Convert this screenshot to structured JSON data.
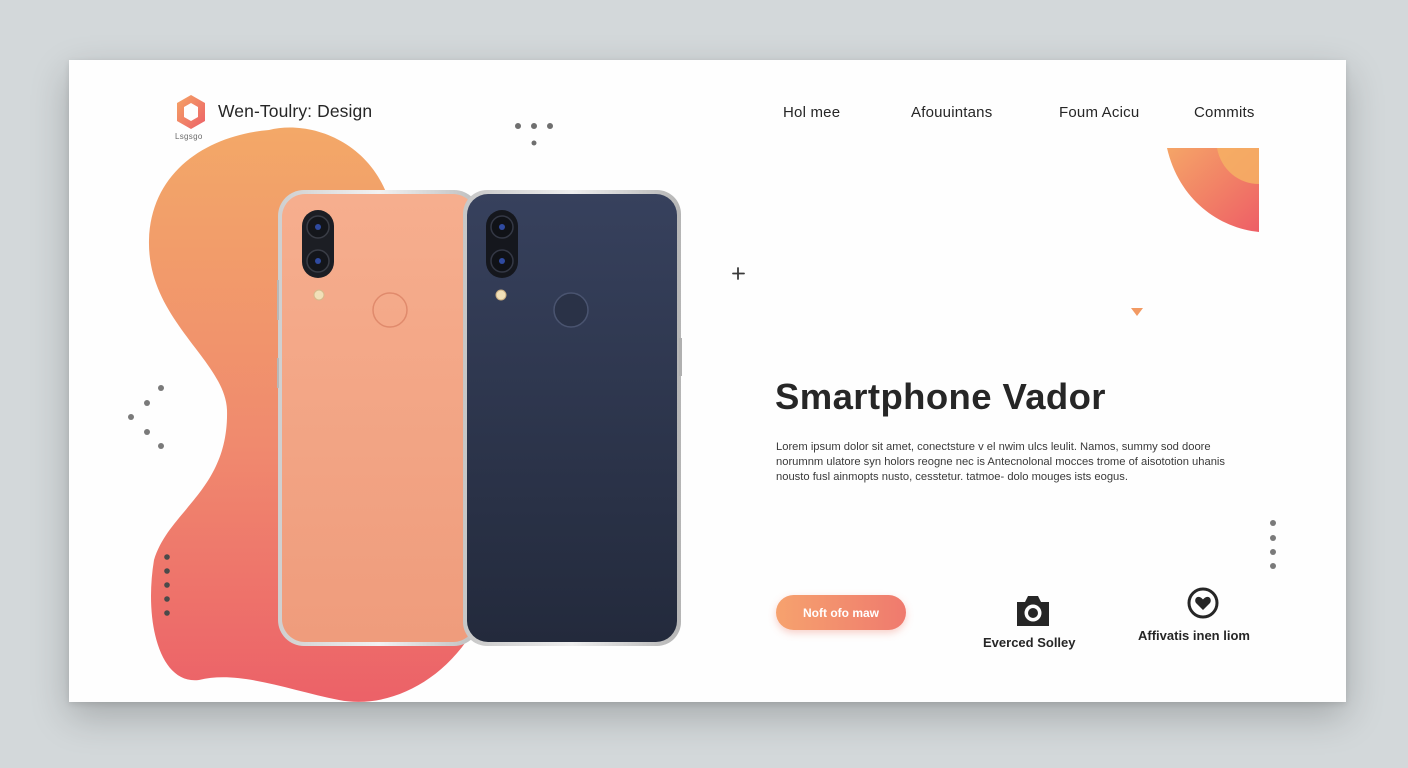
{
  "brand": {
    "name": "Wen-Toulry: Design",
    "sub": "Lsgsgo",
    "logo_icon": "hexagon-logo-icon"
  },
  "nav": {
    "items": [
      "Hol mee",
      "Afouuintans",
      "Foum Acicu",
      "Commits"
    ]
  },
  "hero": {
    "title": "Smartphone Vador",
    "body": "Lorem ipsum dolor sit amet, conectsture v el nwim ulcs leulit. Namos, summy sod doore norumnm ulatore syn holors reogne nec is Antecnolonal mocces trome of aisototion uhanis nousto fusl ainmopts nusto, cesstetur. tatmoe- dolo mouges ists eogus.",
    "cta_label": "Noft ofo maw"
  },
  "features": [
    {
      "icon": "camera-icon",
      "label": "Everced Solley"
    },
    {
      "icon": "heart-badge-icon",
      "label": "Affivatis inen liom"
    }
  ],
  "colors": {
    "accent_orange": "#f4a467",
    "accent_coral": "#ee5f66",
    "phone_peach": "#f2a282",
    "phone_navy": "#2e3750",
    "text_dark": "#262626"
  }
}
